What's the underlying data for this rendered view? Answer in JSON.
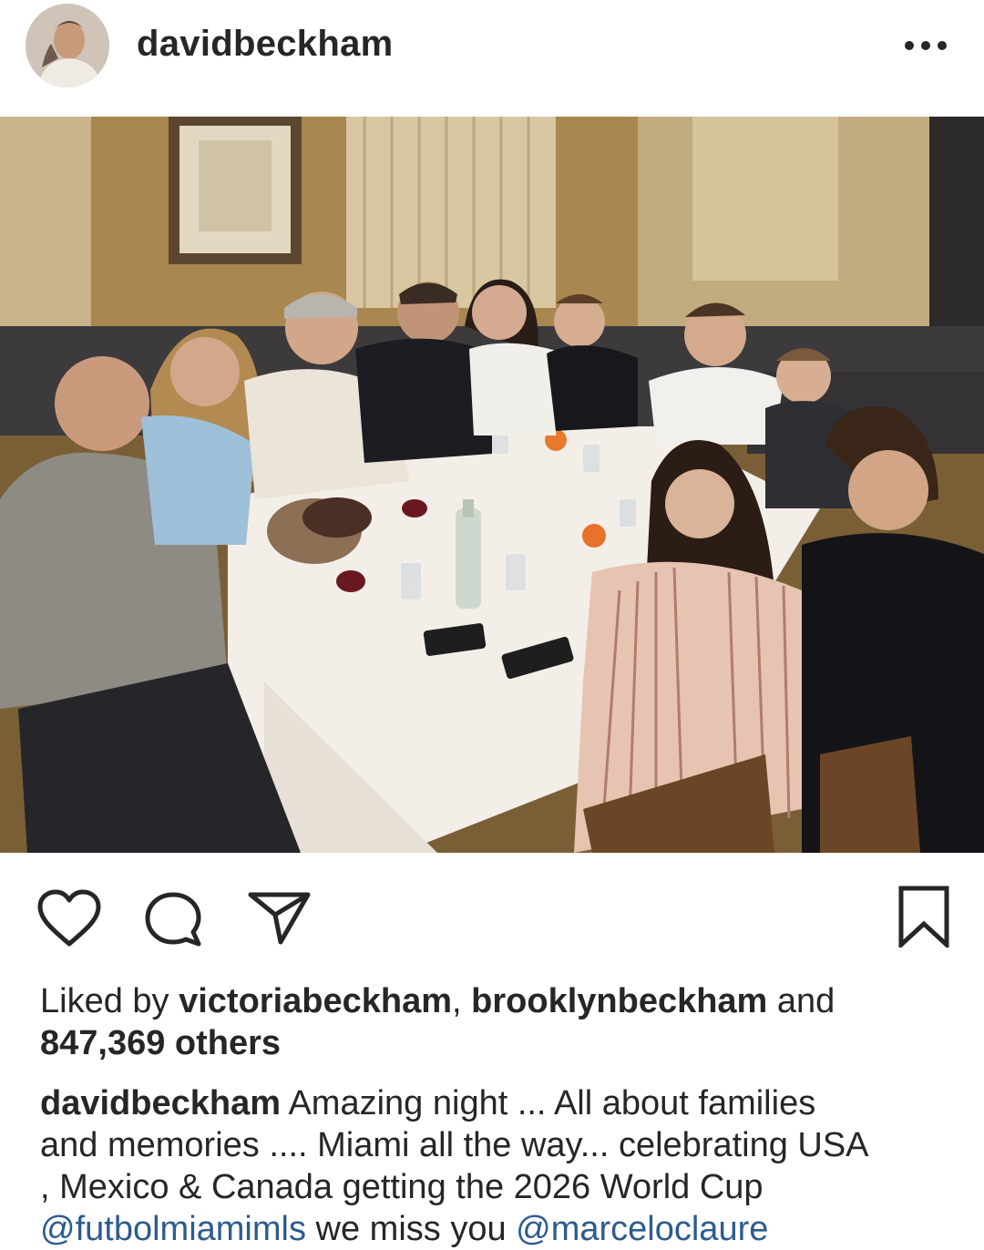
{
  "post": {
    "username": "davidbeckham",
    "photo_alt": "Group photo at a restaurant table"
  },
  "likes": {
    "prefix": "Liked by ",
    "user1": "victoriabeckham",
    "separator": ", ",
    "user2": "brooklynbeckham",
    "and": " and",
    "count": "847,369 others"
  },
  "caption": {
    "username": "davidbeckham",
    "text1": " Amazing night ... All about families",
    "line2": "and memories .... Miami all the way... celebrating USA",
    "line3": ", Mexico & Canada getting the 2026 World Cup",
    "mention1": "@futbolmiamimls",
    "text_mid": " we miss you ",
    "mention2": "@marceloclaure"
  },
  "icons": {
    "avatar": "avatar",
    "more": "more-options-icon",
    "like": "heart-icon",
    "comment": "comment-bubble-icon",
    "share": "paper-plane-icon",
    "save": "bookmark-icon"
  },
  "colors": {
    "text": "#262626",
    "mention": "#2d5b8e",
    "icon": "#262626"
  }
}
